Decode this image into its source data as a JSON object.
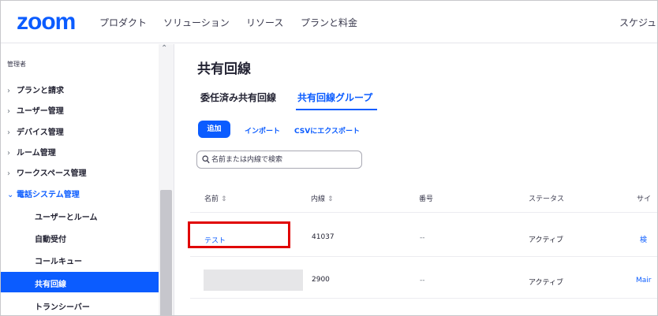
{
  "nav": {
    "logo": "zoom",
    "links": [
      "プロダクト",
      "ソリューション",
      "リソース",
      "プランと料金"
    ],
    "cutoff": "スケジュ"
  },
  "sidebar": {
    "admin_label": "管理者",
    "items": [
      "プランと請求",
      "ユーザー管理",
      "デバイス管理",
      "ルーム管理",
      "ワークスペース管理"
    ],
    "open_item": "電話システム管理",
    "sub_items": [
      "ユーザーとルーム",
      "自動受付",
      "コールキュー"
    ],
    "active_item": "共有回線",
    "trailing_item": "トランシーバー"
  },
  "main": {
    "title": "共有回線",
    "tabs": [
      "委任済み共有回線",
      "共有回線グループ"
    ],
    "add_button": "追加",
    "import_link": "インポート",
    "export_link": "CSVにエクスポート",
    "search_placeholder": "名前または内線で検索",
    "columns": [
      "名前",
      "内線",
      "番号",
      "ステータス",
      "サイ"
    ],
    "rows": [
      {
        "name": "テスト",
        "extension": "41037",
        "number": "--",
        "status": "アクティブ",
        "site": "検"
      },
      {
        "name": "",
        "extension": "2900",
        "number": "--",
        "status": "アクティブ",
        "site": "Mair"
      }
    ]
  },
  "colors": {
    "brand": "#0b5cff",
    "highlight": "#e00000"
  }
}
